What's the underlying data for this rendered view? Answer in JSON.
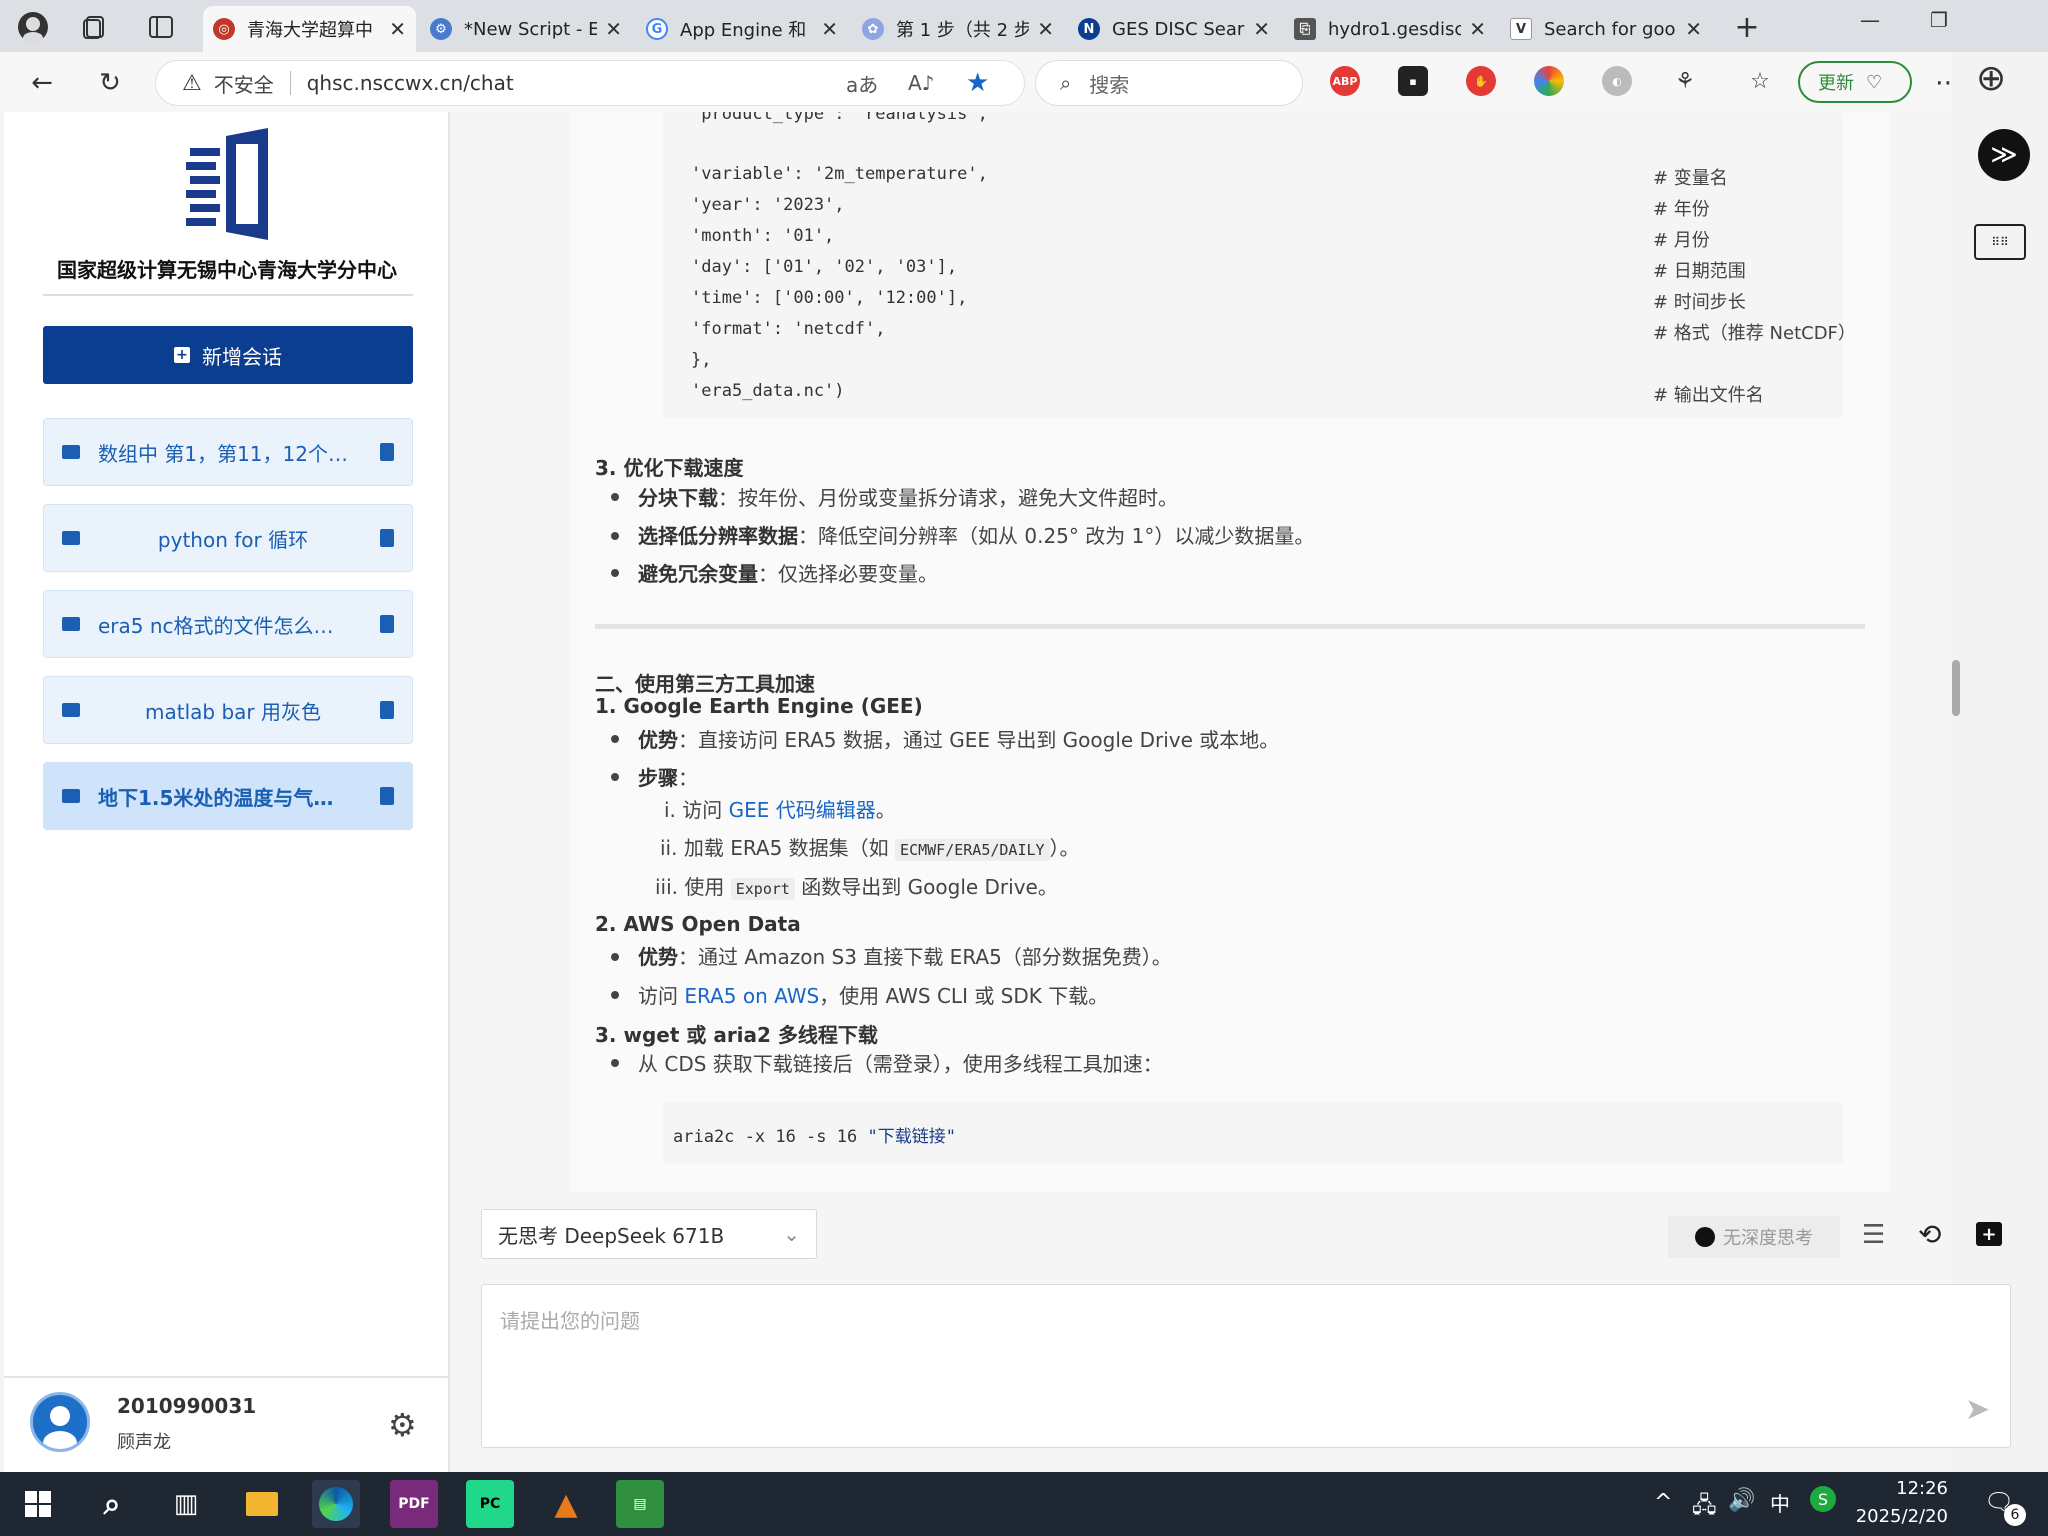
{
  "browser": {
    "tabs": [
      {
        "title": "青海大学超算中",
        "active": true
      },
      {
        "title": "*New Script - E"
      },
      {
        "title": "App Engine 和"
      },
      {
        "title": "第 1 步（共 2 步"
      },
      {
        "title": "GES DISC Searc"
      },
      {
        "title": "hydro1.gesdisc"
      },
      {
        "title": "Search for goo"
      }
    ],
    "security_label": "不安全",
    "url": "qhsc.nsccwx.cn/chat",
    "search_placeholder": "搜索",
    "update_label": "更新",
    "abp_label": "ABP"
  },
  "sidebar": {
    "logo_text": "国家超级计算无锡中心青海大学分中心",
    "new_chat_label": "新增会话",
    "conversations": [
      {
        "label": "数组中 第1，第11，12个…"
      },
      {
        "label": "python for 循环"
      },
      {
        "label": "era5 nc格式的文件怎么…"
      },
      {
        "label": "matlab bar 用灰色"
      },
      {
        "label": "地下1.5米处的温度与气…",
        "active": true
      }
    ],
    "user_id": "2010990031",
    "user_name": "顾声龙"
  },
  "content": {
    "code1": [
      {
        "code": "   'product_type': 'reanalysis',",
        "comment": ""
      },
      {
        "code": "   'variable': '2m_temperature',",
        "comment": "# 变量名"
      },
      {
        "code": "   'year': '2023',",
        "comment": "# 年份"
      },
      {
        "code": "   'month': '01',",
        "comment": "# 月份"
      },
      {
        "code": "   'day': ['01', '02', '03'],",
        "comment": "# 日期范围"
      },
      {
        "code": "   'time': ['00:00', '12:00'],",
        "comment": "# 时间步长"
      },
      {
        "code": "   'format': 'netcdf',",
        "comment": "# 格式（推荐 NetCDF）"
      },
      {
        "code": "},",
        "comment": ""
      },
      {
        "code": "'era5_data.nc')",
        "comment": "# 输出文件名"
      }
    ],
    "s3_heading": "3. 优化下载速度",
    "s3_b1_bold": "分块下载",
    "s3_b1_text": "：按年份、月份或变量拆分请求，避免大文件超时。",
    "s3_b2_bold": "选择低分辨率数据",
    "s3_b2_text": "：降低空间分辨率（如从 0.25° 改为 1°）以减少数据量。",
    "s3_b3_bold": "避免冗余变量",
    "s3_b3_text": "：仅选择必要变量。",
    "sec2_heading": "二、使用第三方工具加速",
    "gee_heading": "1. Google Earth Engine (GEE)",
    "gee_b1_bold": "优势",
    "gee_b1_text": "：直接访问 ERA5 数据，通过 GEE 导出到 Google Drive 或本地。",
    "gee_b2_bold": "步骤",
    "gee_b2_text": "：",
    "gee_s1_num": "i.",
    "gee_s1_pre": "访问 ",
    "gee_s1_link": "GEE 代码编辑器",
    "gee_s1_post": "。",
    "gee_s2_num": "ii.",
    "gee_s2_pre": "加载 ERA5 数据集（如 ",
    "gee_s2_code": "ECMWF/ERA5/DAILY",
    "gee_s2_post": "）。",
    "gee_s3_num": "iii.",
    "gee_s3_pre": "使用 ",
    "gee_s3_code": "Export",
    "gee_s3_post": " 函数导出到 Google Drive。",
    "aws_heading": "2. AWS Open Data",
    "aws_b1_bold": "优势",
    "aws_b1_text": "：通过 Amazon S3 直接下载 ERA5（部分数据免费）。",
    "aws_b2_pre": "访问 ",
    "aws_b2_link": "ERA5 on AWS",
    "aws_b2_post": "，使用 AWS CLI 或 SDK 下载。",
    "wget_heading": "3. wget 或 aria2 多线程下载",
    "wget_b1_text": "从 CDS 获取下载链接后（需登录），使用多线程工具加速：",
    "code2_prefix": "aria2c -x 16 -s 16 ",
    "code2_string": "\"下载链接\""
  },
  "input": {
    "model_label": "无思考 DeepSeek 671B",
    "deep_think_label": "无深度思考",
    "placeholder": "请提出您的问题"
  },
  "taskbar": {
    "time": "12:26",
    "date": "2025/2/20",
    "ime": "中",
    "notif_count": "6",
    "pdf_label": "PDF",
    "pc_label": "PC"
  }
}
